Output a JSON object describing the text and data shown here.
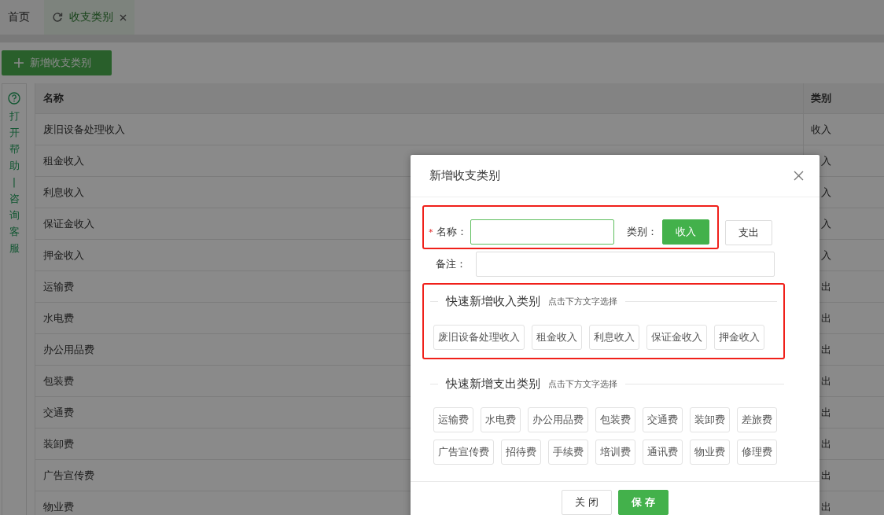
{
  "tabs": [
    {
      "label": "首页",
      "selected": false,
      "closable": false
    },
    {
      "label": "收支类别",
      "selected": true,
      "closable": true
    }
  ],
  "toolbar": {
    "add_button": "新增收支类别"
  },
  "help_sidebar": {
    "label": "打开帮助|咨询客服"
  },
  "table": {
    "columns": [
      "名称",
      "类别"
    ],
    "rows": [
      {
        "name": "废旧设备处理收入",
        "type": "收入"
      },
      {
        "name": "租金收入",
        "type": "入"
      },
      {
        "name": "利息收入",
        "type": "入"
      },
      {
        "name": "保证金收入",
        "type": "入"
      },
      {
        "name": "押金收入",
        "type": "入"
      },
      {
        "name": "运输费",
        "type": "出"
      },
      {
        "name": "水电费",
        "type": "出"
      },
      {
        "name": "办公用品费",
        "type": "出"
      },
      {
        "name": "包装费",
        "type": "出"
      },
      {
        "name": "交通费",
        "type": "出"
      },
      {
        "name": "装卸费",
        "type": "出"
      },
      {
        "name": "广告宣传费",
        "type": "出"
      },
      {
        "name": "物业费",
        "type": "出"
      }
    ]
  },
  "dialog": {
    "title": "新增收支类别",
    "name_row": {
      "highlighted": true,
      "required_mark": "*",
      "label": "名称：",
      "type_label": "类别：",
      "types": [
        {
          "label": "收入",
          "selected": true
        },
        {
          "label": "支出",
          "selected": false
        }
      ]
    },
    "note_label": "备注：",
    "quick_sections": [
      {
        "highlighted": true,
        "title": "快速新增收入类别",
        "hint": "点击下方文字选择",
        "items": [
          "废旧设备处理收入",
          "租金收入",
          "利息收入",
          "保证金收入",
          "押金收入"
        ]
      },
      {
        "highlighted": false,
        "title": "快速新增支出类别",
        "hint": "点击下方文字选择",
        "items": [
          "运输费",
          "水电费",
          "办公用品费",
          "包装费",
          "交通费",
          "装卸费",
          "差旅费",
          "广告宣传费",
          "招待费",
          "手续费",
          "培训费",
          "通讯费",
          "物业费",
          "修理费"
        ]
      }
    ],
    "buttons": [
      {
        "label": "关 闭",
        "kind": "secondary"
      },
      {
        "label": "保 存",
        "kind": "primary"
      }
    ]
  }
}
